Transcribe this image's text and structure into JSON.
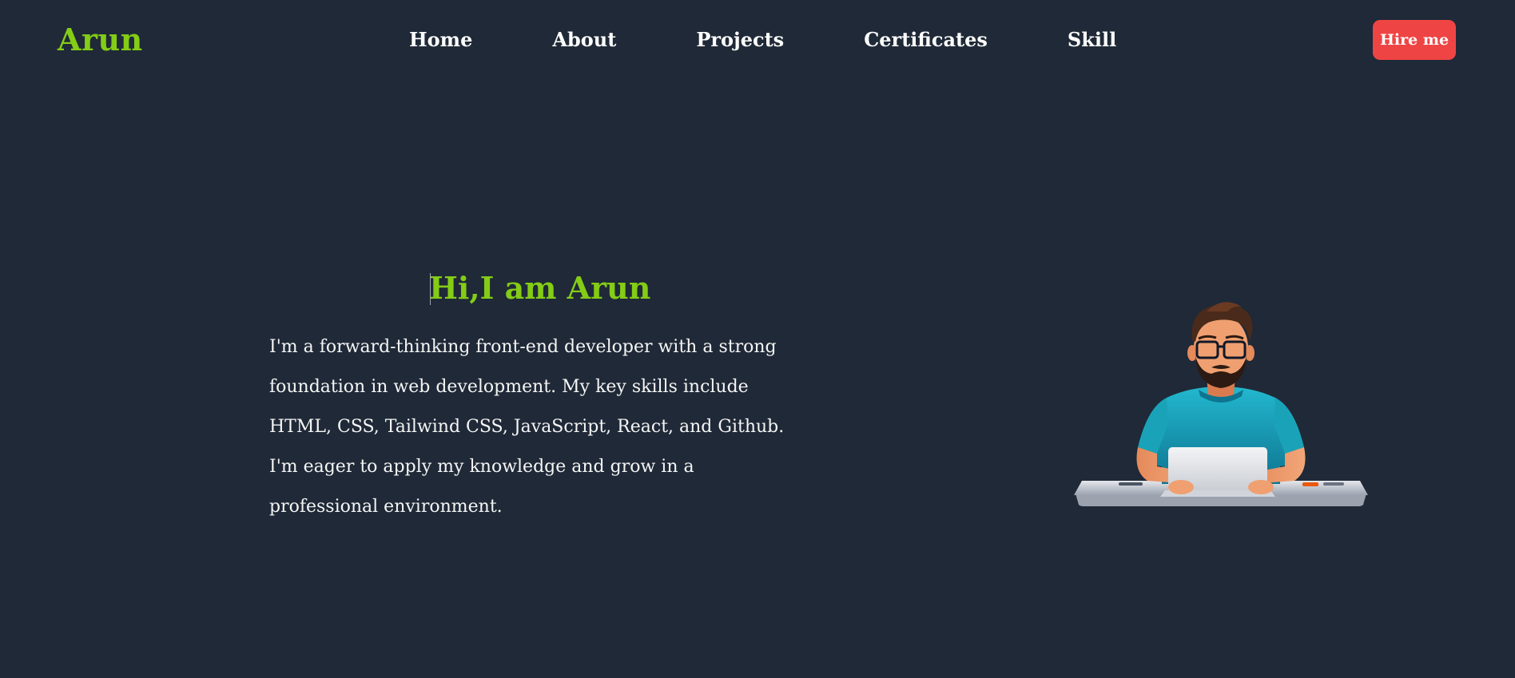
{
  "header": {
    "logo": "Arun",
    "nav": {
      "home": "Home",
      "about": "About",
      "projects": "Projects",
      "certificates": "Certificates",
      "skill": "Skill"
    },
    "hire_label": "Hire me"
  },
  "hero": {
    "title": "Hi,I am Arun",
    "description": "I'm a forward-thinking front-end developer with a strong foundation in web development. My key skills include HTML, CSS, Tailwind CSS, JavaScript, React, and Github. I'm eager to apply my knowledge and grow in a professional environment."
  },
  "colors": {
    "background": "#1f2937",
    "accent": "#84cc16",
    "button": "#ef4444",
    "text": "#ffffff"
  },
  "icons": {
    "illustration": "developer-with-laptop-illustration"
  }
}
